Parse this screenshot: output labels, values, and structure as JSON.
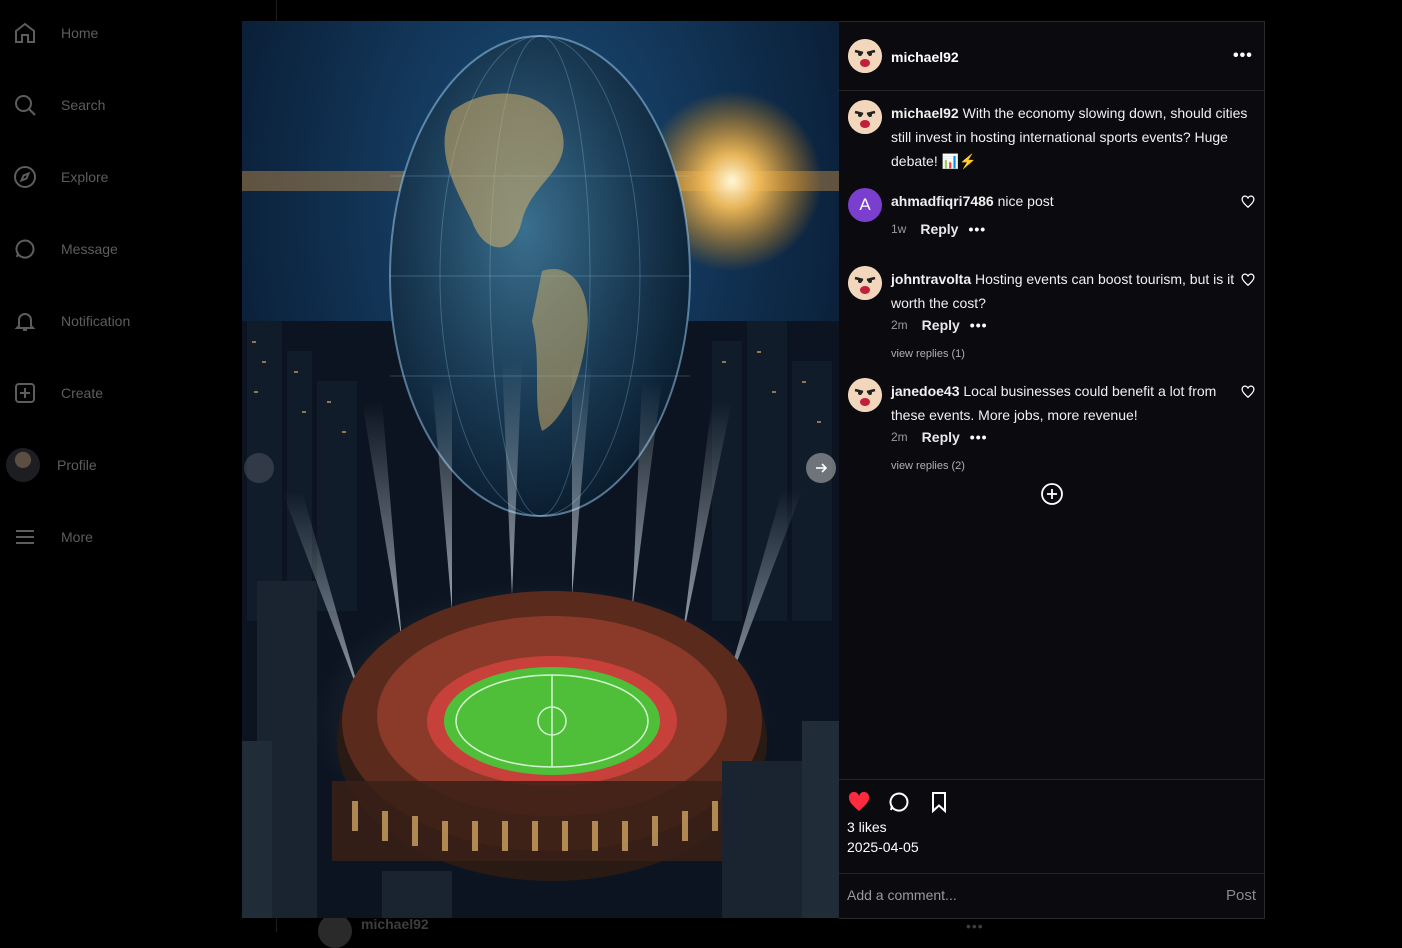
{
  "sidebar": {
    "items": [
      {
        "label": "Home",
        "icon": "home-icon"
      },
      {
        "label": "Search",
        "icon": "search-icon"
      },
      {
        "label": "Explore",
        "icon": "compass-icon"
      },
      {
        "label": "Message",
        "icon": "chat-bubble-icon"
      },
      {
        "label": "Notification",
        "icon": "bell-icon"
      },
      {
        "label": "Create",
        "icon": "plus-square-icon"
      },
      {
        "label": "Profile",
        "icon": "avatar"
      },
      {
        "label": "More",
        "icon": "menu-icon"
      }
    ]
  },
  "feed_behind": {
    "username": "michael92",
    "more": "•••"
  },
  "post": {
    "author": "michael92",
    "more": "•••",
    "caption": {
      "username": "michael92",
      "text": "With the economy slowing down, should cities still invest in hosting international sports events? Huge debate!",
      "emoji": "📊⚡"
    },
    "comments": [
      {
        "username": "ahmadfiqri7486",
        "avatar_letter": "A",
        "text": "nice post",
        "time": "1w",
        "reply": "Reply",
        "more": "•••"
      },
      {
        "username": "johntravolta",
        "text": "Hosting events can boost tourism, but is it worth the cost?",
        "time": "2m",
        "reply": "Reply",
        "more": "•••",
        "view_replies": "view replies (1)"
      },
      {
        "username": "janedoe43",
        "text": "Local businesses could benefit a lot from these events. More jobs, more revenue!",
        "time": "2m",
        "reply": "Reply",
        "more": "•••",
        "view_replies": "view replies (2)"
      }
    ],
    "likes": "3 likes",
    "date": "2025-04-05",
    "comment_placeholder": "Add a comment...",
    "post_label": "Post",
    "colors": {
      "like": "#ff2a3d",
      "accent_avatar": "#7b3fd0"
    }
  }
}
